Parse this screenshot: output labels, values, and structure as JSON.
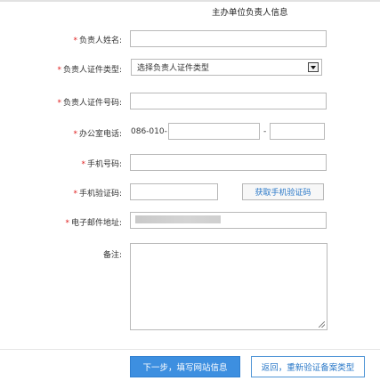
{
  "section": {
    "title": "主办单位负责人信息"
  },
  "fields": {
    "name": {
      "required_mark": "*",
      "label": "负责人姓名:",
      "value": ""
    },
    "id_type": {
      "required_mark": "*",
      "label": "负责人证件类型:",
      "selected": "选择负责人证件类型"
    },
    "id_number": {
      "required_mark": "*",
      "label": "负责人证件号码:",
      "value": ""
    },
    "office_phone": {
      "required_mark": "*",
      "label": "办公室电话:",
      "prefix": "086-010-",
      "separator": "-",
      "value_main": "",
      "value_ext": ""
    },
    "mobile": {
      "required_mark": "*",
      "label": "手机号码:",
      "value": ""
    },
    "sms_code": {
      "required_mark": "*",
      "label": "手机验证码:",
      "value": "",
      "button": "获取手机验证码"
    },
    "email": {
      "required_mark": "*",
      "label": "电子邮件地址:"
    },
    "remarks": {
      "label": "备注:"
    }
  },
  "actions": {
    "next": "下一步，填写网站信息",
    "back": "返回，重新验证备案类型"
  },
  "colors": {
    "primary": "#3d8fe0",
    "link": "#2a78c8",
    "required": "#e02020"
  }
}
